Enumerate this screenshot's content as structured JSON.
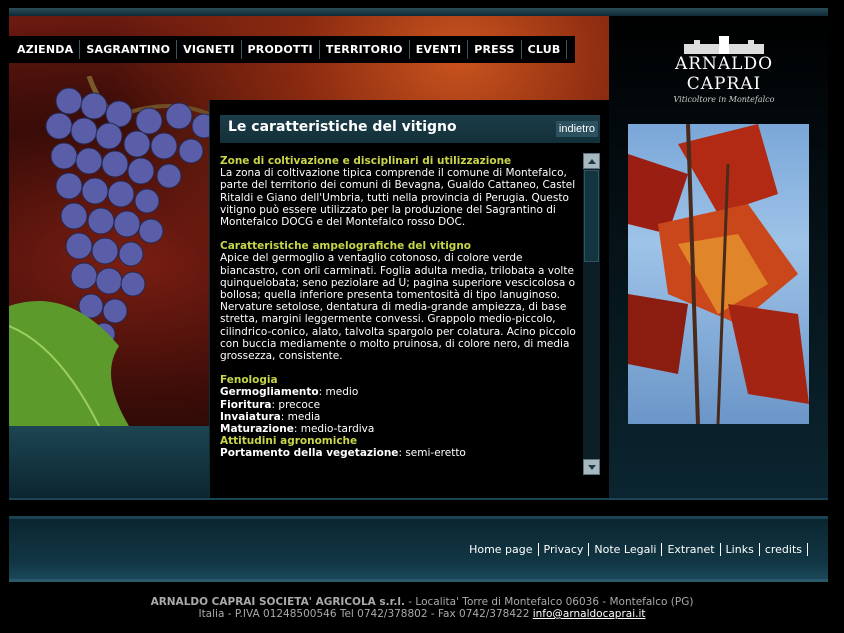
{
  "nav": [
    "AZIENDA",
    "SAGRANTINO",
    "VIGNETI",
    "PRODOTTI",
    "TERRITORIO",
    "EVENTI",
    "PRESS",
    "CLUB"
  ],
  "logo": {
    "name": "ARNALDO CAPRAI",
    "tagline": "Viticoltore in Montefalco"
  },
  "panel": {
    "title": "Le caratteristiche del vitigno",
    "back_label": "indietro",
    "sections": [
      {
        "title": "Zone di coltivazione e disciplinari di utilizzazione",
        "body": "La zona di coltivazione tipica comprende il comune di Montefalco, parte del territorio dei comuni di Bevagna, Gualdo Cattaneo, Castel Ritaldi e Giano dell'Umbria, tutti nella provincia di Perugia. Questo vitigno può essere utilizzato per la produzione del Sagrantino di Montefalco DOCG e del Montefalco rosso DOC."
      },
      {
        "title": "Caratteristiche ampelografiche del vitigno",
        "body": "Apice del germoglio a ventaglio cotonoso, di colore verde biancastro, con orli carminati. Foglia adulta media, trilobata a volte quinquelobata; seno peziolare ad U; pagina superiore vescicolosa o bollosa; quella inferiore presenta tomentosità di tipo lanuginoso. Nervature setolose, dentatura di media-grande ampiezza, di base stretta, margini leggermente convessi. Grappolo medio-piccolo, cilindrico-conico, alato, talvolta spargolo per colatura. Acino piccolo con buccia mediamente o molto pruinosa, di colore nero, di media grossezza, consistente."
      }
    ],
    "fenologia": {
      "title": "Fenologia",
      "items": [
        {
          "k": "Germogliamento",
          "v": "medio"
        },
        {
          "k": "Fioritura",
          "v": "precoce"
        },
        {
          "k": "Invaiatura",
          "v": "media"
        },
        {
          "k": "Maturazione",
          "v": "medio-tardiva"
        }
      ]
    },
    "attitudini": {
      "title": "Attitudini agronomiche",
      "items": [
        {
          "k": "Portamento della vegetazione",
          "v": "semi-eretto"
        }
      ]
    }
  },
  "footer": {
    "links": [
      "Home page",
      "Privacy",
      "Note Legali",
      "Extranet",
      "Links",
      "credits"
    ],
    "company": "ARNALDO CAPRAI SOCIETA' AGRICOLA s.r.l.",
    "address1": " - Localita' Torre di Montefalco 06036 - Montefalco (PG)",
    "address2": "Italia - P.IVA 01248500546 Tel 0742/378802 - Fax 0742/378422 ",
    "email": "info@arnaldocaprai.it"
  }
}
